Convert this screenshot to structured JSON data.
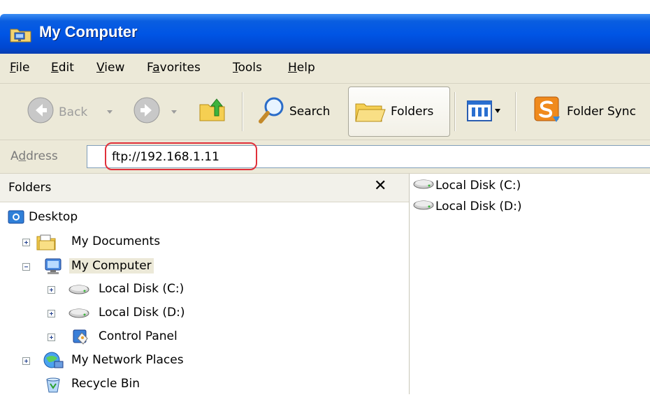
{
  "window": {
    "title": "My Computer"
  },
  "menu": {
    "file": "F",
    "file_rest": "ile",
    "edit": "E",
    "edit_rest": "dit",
    "view": "V",
    "view_rest": "iew",
    "favorites_pre": "F",
    "favorites_u": "a",
    "favorites_rest": "vorites",
    "tools": "T",
    "tools_rest": "ools",
    "help": "H",
    "help_rest": "elp"
  },
  "toolbar": {
    "back_label": "Back",
    "search_label": "Search",
    "folders_label": "Folders",
    "folder_sync_label": "Folder Sync"
  },
  "address": {
    "label_a": "A",
    "label_d": "d",
    "label_rest": "dress",
    "value": "ftp://192.168.1.11"
  },
  "folders_pane": {
    "title": "Folders",
    "close_glyph": "✕",
    "tree": [
      {
        "label": "Desktop"
      },
      {
        "label": "My Documents"
      },
      {
        "label": "My Computer"
      },
      {
        "label": "Local Disk (C:)"
      },
      {
        "label": "Local Disk (D:)"
      },
      {
        "label": "Control Panel"
      },
      {
        "label": "My Network Places"
      },
      {
        "label": "Recycle Bin"
      }
    ]
  },
  "content": {
    "items": [
      {
        "label": "Local Disk (C:)"
      },
      {
        "label": "Local Disk (D:)"
      }
    ]
  },
  "colors": {
    "titlebar": "#0055e5",
    "chrome": "#ece9d8",
    "highlight_ring": "#e0303a"
  }
}
